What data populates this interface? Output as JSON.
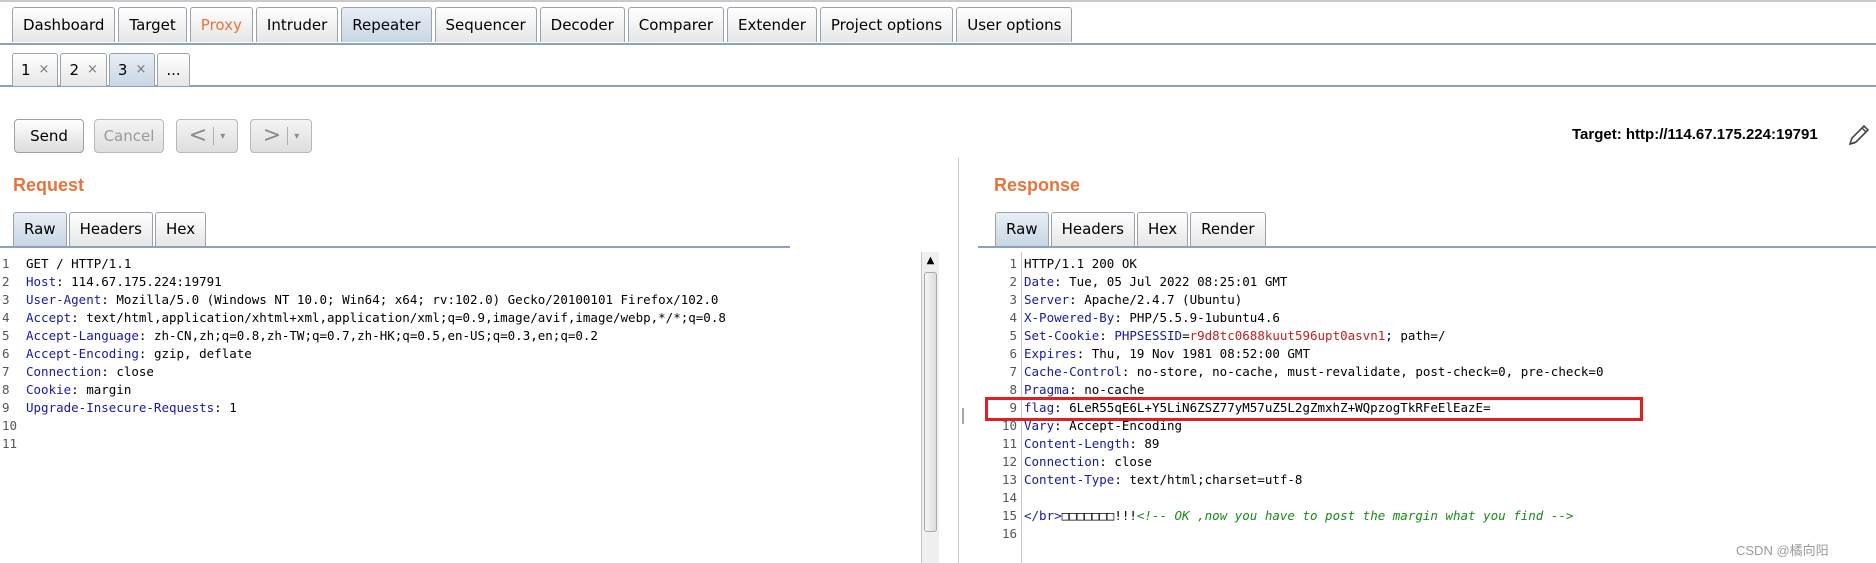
{
  "main_tabs": [
    "Dashboard",
    "Target",
    "Proxy",
    "Intruder",
    "Repeater",
    "Sequencer",
    "Decoder",
    "Comparer",
    "Extender",
    "Project options",
    "User options"
  ],
  "sub_tabs": [
    {
      "label": "1",
      "close": "×"
    },
    {
      "label": "2",
      "close": "×"
    },
    {
      "label": "3",
      "close": "×"
    },
    {
      "label": "...",
      "close": ""
    }
  ],
  "toolbar": {
    "send_label": "Send",
    "cancel_label": "Cancel",
    "back_arrow": "<",
    "forward_arrow": ">",
    "caret": "▾",
    "target_label": "Target: http://114.67.175.224:19791"
  },
  "request": {
    "title": "Request",
    "tabs": [
      "Raw",
      "Headers",
      "Hex"
    ],
    "line_numbers": [
      "1",
      "2",
      "3",
      "4",
      "5",
      "6",
      "7",
      "8",
      "9",
      "10",
      "11"
    ],
    "lines": [
      {
        "k": "",
        "v": "GET / HTTP/1.1"
      },
      {
        "k": "Host",
        "v": ": 114.67.175.224:19791"
      },
      {
        "k": "User-Agent",
        "v": ": Mozilla/5.0 (Windows NT 10.0; Win64; x64; rv:102.0) Gecko/20100101 Firefox/102.0"
      },
      {
        "k": "Accept",
        "v": ": text/html,application/xhtml+xml,application/xml;q=0.9,image/avif,image/webp,*/*;q=0.8"
      },
      {
        "k": "Accept-Language",
        "v": ": zh-CN,zh;q=0.8,zh-TW;q=0.7,zh-HK;q=0.5,en-US;q=0.3,en;q=0.2"
      },
      {
        "k": "Accept-Encoding",
        "v": ": gzip, deflate"
      },
      {
        "k": "Connection",
        "v": ": close"
      },
      {
        "k": "Cookie",
        "v": ": margin"
      },
      {
        "k": "Upgrade-Insecure-Requests",
        "v": ": 1"
      },
      {
        "k": "",
        "v": ""
      },
      {
        "k": "",
        "v": ""
      }
    ]
  },
  "response": {
    "title": "Response",
    "tabs": [
      "Raw",
      "Headers",
      "Hex",
      "Render"
    ],
    "line_numbers": [
      "1",
      "2",
      "3",
      "4",
      "5",
      "6",
      "7",
      "8",
      "9",
      "10",
      "11",
      "12",
      "13",
      "14",
      "15",
      "16"
    ],
    "lines": {
      "l1": "HTTP/1.1 200 OK",
      "l2k": "Date",
      "l2v": ": Tue, 05 Jul 2022 08:25:01 GMT",
      "l3k": "Server",
      "l3v": ": Apache/2.4.7 (Ubuntu)",
      "l4k": "X-Powered-By",
      "l4v": ": PHP/5.5.9-1ubuntu4.6",
      "l5k": "Set-Cookie",
      "l5a": ": ",
      "l5n": "PHPSESSID",
      "l5eq": "=",
      "l5c": "r9d8tc0688kuut596upt0asvn1",
      "l5e": "; path=/",
      "l6k": "Expires",
      "l6v": ": Thu, 19 Nov 1981 08:52:00 GMT",
      "l7k": "Cache-Control",
      "l7v": ": no-store, no-cache, must-revalidate, post-check=0, pre-check=0",
      "l8k": "Pragma",
      "l8v": ": no-cache",
      "l9k": "flag",
      "l9v": ": 6LeR55qE6L+Y5LiN6ZSZ77yM57uZ5L2gZmxhZ+WQpzogTkRFeElEazE=",
      "l10k": "Vary",
      "l10v": ": Accept-Encoding",
      "l11k": "Content-Length",
      "l11v": ": 89",
      "l12k": "Connection",
      "l12v": ": close",
      "l13k": "Content-Type",
      "l13v": ": text/html;charset=utf-8",
      "l15tag": "</br>",
      "l15text": "□□□□□□□!!!",
      "l15cmt": "<!-- OK ,now you have to post the margin what you find -->"
    }
  },
  "watermark": "CSDN @橘向阳",
  "colors": {
    "accent": "#e8743b",
    "header_key": "#1a1a9c",
    "cookie_value": "#c02020",
    "comment": "#1a8a1a",
    "highlight_box": "#e02020"
  }
}
